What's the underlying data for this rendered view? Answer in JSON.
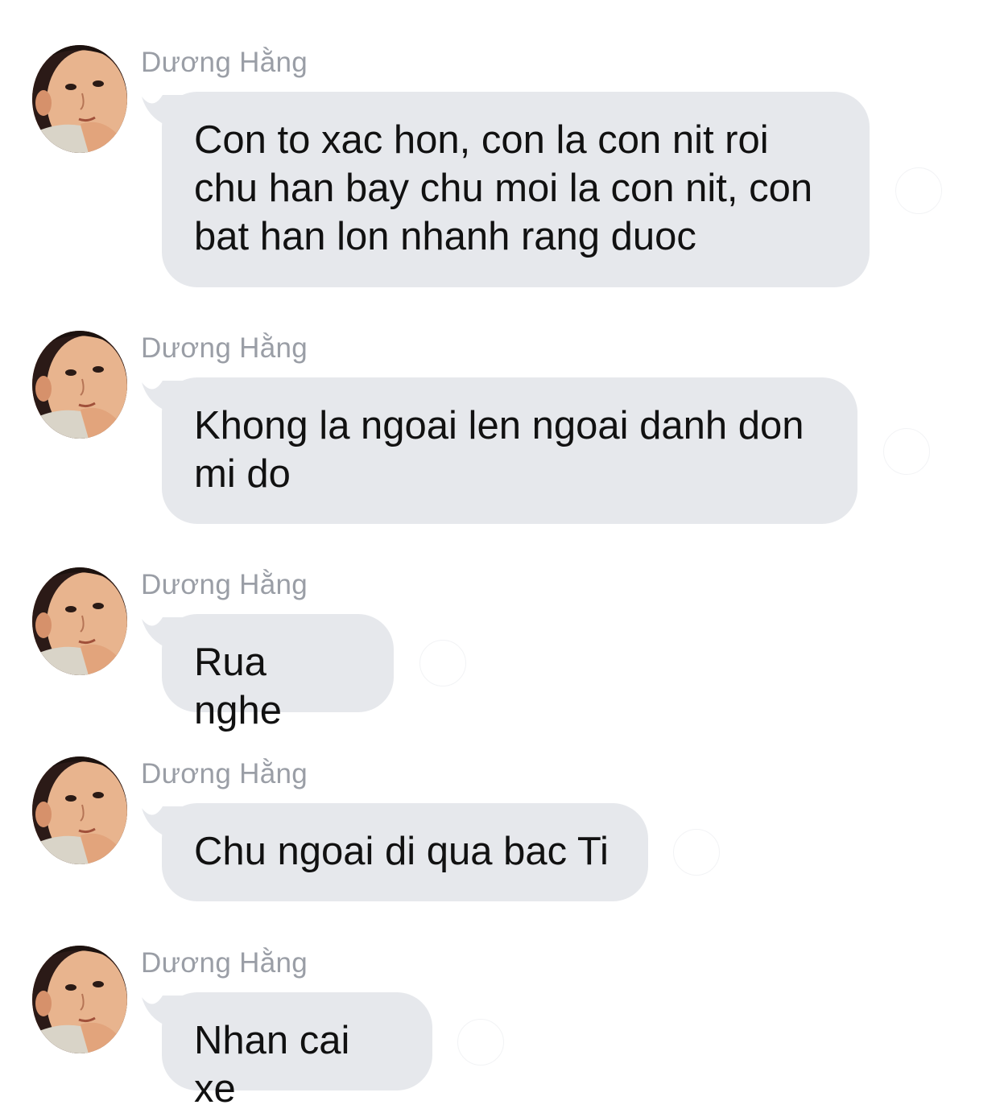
{
  "messages": [
    {
      "sender": "Dương Hằng",
      "text": "Con to xac hon, con la con nit roi chu han bay chu moi la con nit, con bat han lon nhanh rang duoc"
    },
    {
      "sender": "Dương Hằng",
      "text": "Khong la ngoai len ngoai danh don mi do"
    },
    {
      "sender": "Dương Hằng",
      "text": "Rua nghe"
    },
    {
      "sender": "Dương Hằng",
      "text": "Chu ngoai di qua bac Ti"
    },
    {
      "sender": "Dương Hằng",
      "text": "Nhan cai xe"
    }
  ],
  "colors": {
    "bubble_bg": "#e6e8ec",
    "sender_name": "#9a9ea6",
    "message_text": "#111111",
    "background": "#ffffff"
  },
  "icons": {
    "avatar": "child-portrait-avatar",
    "reaction": "reaction-placeholder-icon"
  }
}
